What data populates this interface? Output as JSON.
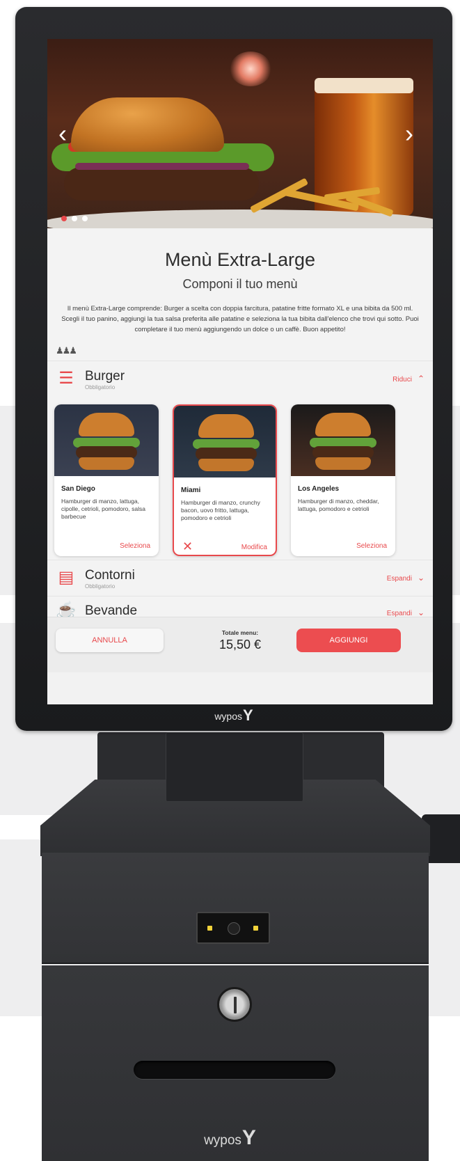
{
  "hero": {
    "prev_icon": "chevron-left-icon",
    "next_icon": "chevron-right-icon",
    "slides": 3,
    "active_slide": 1
  },
  "menu": {
    "title": "Menù Extra-Large",
    "subtitle": "Componi il tuo menù",
    "description": "Il menù Extra-Large comprende: Burger a scelta con doppia farcitura, patatine fritte formato XL e una bibita da 500 ml. Scegli il tuo panino, aggiungi la tua salsa preferita alle patatine e seleziona la tua bibita dall'elenco che trovi qui sotto. Puoi completare il tuo menù aggiungendo un dolce o un caffè. Buon appetito!"
  },
  "sections": [
    {
      "name": "Burger",
      "required": "Obbligatorio",
      "action": "Riduci",
      "icon": "burger-icon",
      "chevron": "chevron-up-icon"
    },
    {
      "name": "Contorni",
      "required": "Obbligatorio",
      "action": "Espandi",
      "icon": "fries-icon",
      "chevron": "chevron-down-icon"
    },
    {
      "name": "Bevande",
      "required": "",
      "action": "Espandi",
      "icon": "drink-icon",
      "chevron": "chevron-down-icon"
    }
  ],
  "products": [
    {
      "name": "San Diego",
      "description": "Hamburger di manzo, lattuga, cipolle, cetrioli, pomodoro, salsa barbecue",
      "action": "Seleziona",
      "selected": false
    },
    {
      "name": "Miami",
      "description": "Hamburger di manzo, crunchy bacon, uovo fritto, lattuga, pomodoro e cetrioli",
      "action": "Modifica",
      "selected": true
    },
    {
      "name": "Los Angeles",
      "description": "Hamburger di manzo, cheddar, lattuga, pomodoro e cetrioli",
      "action": "Seleziona",
      "selected": false
    }
  ],
  "footer": {
    "cancel_label": "ANNULLA",
    "total_label": "Totale menu:",
    "total_value": "15,50 €",
    "add_label": "AGGIUNGI"
  },
  "branding": {
    "bezel_logo": "wypos",
    "cabinet_logo": "wypos"
  },
  "colors": {
    "accent": "#e8494c",
    "kiosk_body": "#2b2c2f",
    "screen_bg": "#f3f3f3"
  }
}
